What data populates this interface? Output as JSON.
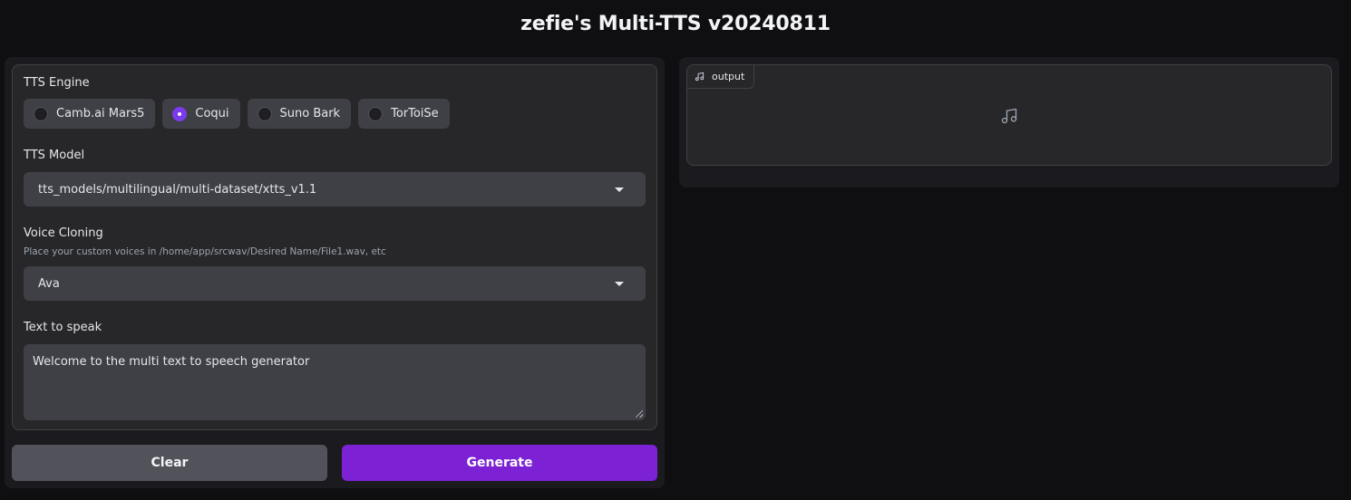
{
  "header": {
    "title": "zefie's Multi-TTS v20240811"
  },
  "form": {
    "engine": {
      "label": "TTS Engine",
      "options": [
        {
          "label": "Camb.ai Mars5",
          "checked": false
        },
        {
          "label": "Coqui",
          "checked": true
        },
        {
          "label": "Suno Bark",
          "checked": false
        },
        {
          "label": "TorToiSe",
          "checked": false
        }
      ]
    },
    "model": {
      "label": "TTS Model",
      "value": "tts_models/multilingual/multi-dataset/xtts_v1.1"
    },
    "voice": {
      "label": "Voice Cloning",
      "info": "Place your custom voices in /home/app/srcwav/Desired Name/File1.wav, etc",
      "value": "Ava"
    },
    "text": {
      "label": "Text to speak",
      "value": "Welcome to the multi text to speech generator"
    }
  },
  "actions": {
    "clear_label": "Clear",
    "generate_label": "Generate"
  },
  "output": {
    "label": "output",
    "icon": "music-note-icon"
  },
  "colors": {
    "accent": "#7c22d4",
    "background": "#0f0f11",
    "panel": "#27272a"
  }
}
